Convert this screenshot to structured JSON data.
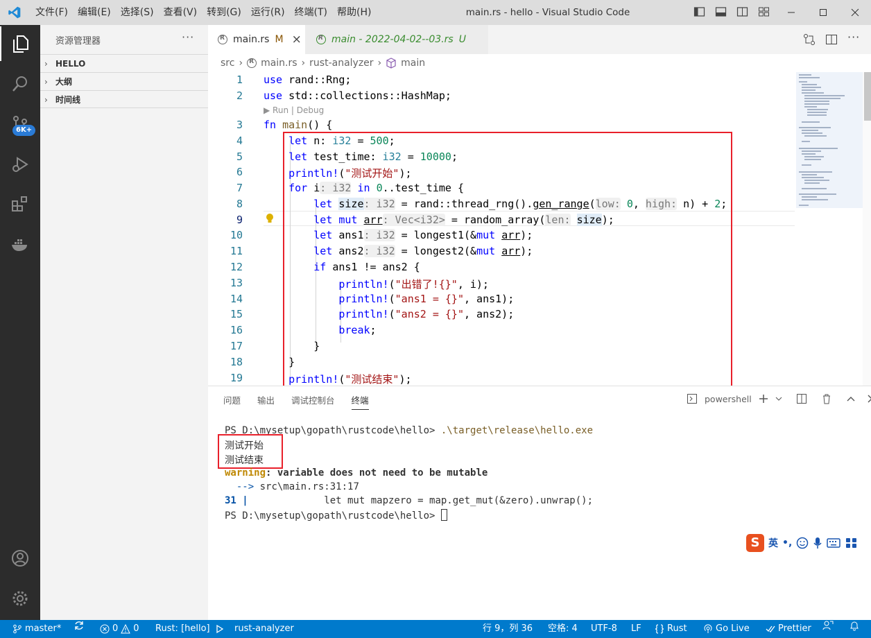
{
  "window": {
    "title": "main.rs - hello - Visual Studio Code",
    "menu": [
      "文件(F)",
      "编辑(E)",
      "选择(S)",
      "查看(V)",
      "转到(G)",
      "运行(R)",
      "终端(T)",
      "帮助(H)"
    ]
  },
  "activity": {
    "scm_badge": "6K+"
  },
  "sidebar": {
    "title": "资源管理器",
    "more": "···",
    "sections": [
      "HELLO",
      "大纲",
      "时间线"
    ]
  },
  "tabs": [
    {
      "label": "main.rs",
      "status": "M",
      "close": "×"
    },
    {
      "label": "main - 2022-04-02--03.rs",
      "status": "U"
    }
  ],
  "breadcrumb": [
    "src",
    "main.rs",
    "rust-analyzer",
    "main"
  ],
  "editor": {
    "codelens": "▶ Run | Debug",
    "line_numbers": [
      "1",
      "2",
      "3",
      "4",
      "5",
      "6",
      "7",
      "8",
      "9",
      "10",
      "11",
      "12",
      "13",
      "14",
      "15",
      "16",
      "17",
      "18",
      "19"
    ]
  },
  "panel": {
    "tabs": [
      "问题",
      "输出",
      "调试控制台",
      "终端"
    ],
    "shell": "powershell",
    "terminal": {
      "prompt1": "PS D:\\mysetup\\gopath\\rustcode\\hello> ",
      "cmd": ".\\target\\release\\hello.exe",
      "out1": "测试开始",
      "out2": "测试结束",
      "warn_label": "warning",
      "warn_msg": ": variable does not need to be mutable",
      "loc_arrow": "  -->",
      "loc": " src\\main.rs:31:17",
      "src_lineno": "31 |",
      "src_line": "             let mut mapzero = map.get_mut(&zero).unwrap();",
      "prompt2": "PS D:\\mysetup\\gopath\\rustcode\\hello> "
    }
  },
  "ime": {
    "label": "英"
  },
  "statusbar": {
    "branch": "master*",
    "errors": "0",
    "warnings": "0",
    "rust": "Rust: [hello]",
    "analyzer": "rust-analyzer",
    "position": "行 9，列 36",
    "spaces": "空格: 4",
    "encoding": "UTF-8",
    "eol": "LF",
    "lang": "Rust",
    "golive": "Go Live",
    "prettier": "Prettier"
  },
  "colors": {
    "accent": "#007acc",
    "highlight_box": "#e8202a",
    "activity_bg": "#2c2c2c"
  }
}
